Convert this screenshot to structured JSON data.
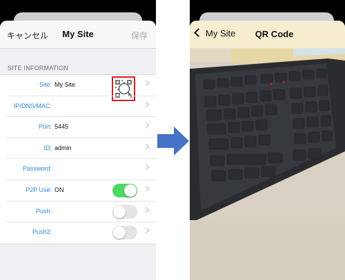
{
  "left_screen": {
    "nav": {
      "cancel": "キャンセル",
      "title": "My Site",
      "save": "保存"
    },
    "section_header": "SITE INFORMATION",
    "rows": [
      {
        "label": "Site:",
        "value": "My Site",
        "control": "qr"
      },
      {
        "label": "IP/DNS/MAC:",
        "value": ""
      },
      {
        "label": "Port:",
        "value": "5445"
      },
      {
        "label": "ID:",
        "value": "admin"
      },
      {
        "label": "Password:",
        "value": ""
      },
      {
        "label": "P2P Use:",
        "value": "ON",
        "control": "toggle",
        "on": true
      },
      {
        "label": "Push:",
        "value": "",
        "control": "toggle",
        "on": false
      },
      {
        "label": "Push2:",
        "value": "",
        "control": "toggle",
        "on": false
      }
    ],
    "colors": {
      "label_blue": "#2f86d7",
      "toggle_on": "#4cd964",
      "highlight_red": "#d21e25"
    }
  },
  "arrow": {
    "color": "#4472c4",
    "icon": "right-arrow-icon"
  },
  "right_screen": {
    "nav": {
      "back": "My Site",
      "title": "QR Code"
    },
    "camera_view": "keyboard-photo"
  }
}
